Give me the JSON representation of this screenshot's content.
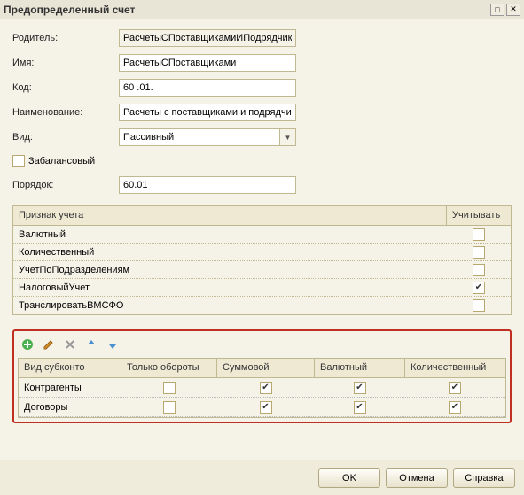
{
  "window": {
    "title": "Предопределенный счет"
  },
  "form": {
    "parent_label": "Родитель:",
    "parent_value": "РасчетыСПоставщикамиИПодрядчик",
    "name_label": "Имя:",
    "name_value": "РасчетыСПоставщиками",
    "code_label": "Код:",
    "code_value": "60 .01.",
    "desc_label": "Наименование:",
    "desc_value": "Расчеты с поставщиками и подрядчи",
    "kind_label": "Вид:",
    "kind_value": "Пассивный",
    "offbalance_label": "Забалансовый",
    "offbalance_checked": false,
    "order_label": "Порядок:",
    "order_value": "60.01"
  },
  "attr_table": {
    "header_name": "Признак учета",
    "header_use": "Учитывать",
    "rows": [
      {
        "name": "Валютный",
        "checked": false
      },
      {
        "name": "Количественный",
        "checked": false
      },
      {
        "name": "УчетПоПодразделениям",
        "checked": false
      },
      {
        "name": "НалоговыйУчет",
        "checked": true
      },
      {
        "name": "ТранслироватьВМСФО",
        "checked": false
      }
    ]
  },
  "subkonto": {
    "headers": [
      "Вид субконто",
      "Только обороты",
      "Суммовой",
      "Валютный",
      "Количественный"
    ],
    "rows": [
      {
        "name": "Контрагенты",
        "only_turnover": false,
        "sum": true,
        "currency": true,
        "qty": true
      },
      {
        "name": "Договоры",
        "only_turnover": false,
        "sum": true,
        "currency": true,
        "qty": true
      }
    ]
  },
  "footer": {
    "ok": "OK",
    "cancel": "Отмена",
    "help": "Справка"
  }
}
